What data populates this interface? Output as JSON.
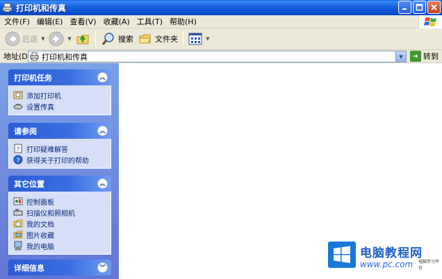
{
  "window": {
    "title": "打印机和传真"
  },
  "menu": [
    "文件(F)",
    "编辑(E)",
    "查看(V)",
    "收藏(A)",
    "工具(T)",
    "帮助(H)"
  ],
  "toolbar": {
    "back": "后退",
    "search": "搜索",
    "folders": "文件夹"
  },
  "address": {
    "label": "地址(D)",
    "value": "打印机和传真",
    "go": "转到"
  },
  "taskpane": {
    "printer_tasks": {
      "title": "打印机任务",
      "items": [
        "添加打印机",
        "设置传真"
      ]
    },
    "see_also": {
      "title": "请参阅",
      "items": [
        "打印疑难解答",
        "获得关于打印的帮助"
      ]
    },
    "other_places": {
      "title": "其它位置",
      "items": [
        "控制面板",
        "扫描仪和照相机",
        "我的文档",
        "图片收藏",
        "我的电脑"
      ]
    },
    "details": {
      "title": "详细信息"
    }
  },
  "watermark": {
    "name": "电脑教程网",
    "url": "www.pc.com",
    "tag": "电脑学习平台"
  },
  "colors": {
    "titlebar": "#0f55d6",
    "taskpane": "#7ba2e7",
    "link": "#0c2a7a"
  }
}
